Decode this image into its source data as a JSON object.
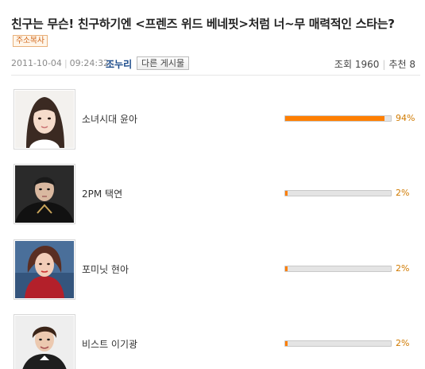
{
  "post": {
    "title": "친구는 무슨! 친구하기엔 <프렌즈 위드 베네핏>처럼 너~무 매력적인 스타는?",
    "copy_address_label": "주소복사",
    "date": "2011-10-04",
    "time": "09:24:32",
    "author": "조누리",
    "other_posts_label": "다른 게시물",
    "views_label": "조회",
    "views": "1960",
    "recommend_label": "추천",
    "recommend": "8"
  },
  "poll": {
    "accent_color": "#ff7f00",
    "items": [
      {
        "name": "소녀시대 윤아",
        "percent_label": "94%",
        "percent": 94,
        "photo": "portrait-photo"
      },
      {
        "name": "2PM 택연",
        "percent_label": "2%",
        "percent": 2,
        "photo": "portrait-photo"
      },
      {
        "name": "포미닛 현아",
        "percent_label": "2%",
        "percent": 2,
        "photo": "portrait-photo"
      },
      {
        "name": "비스트 이기광",
        "percent_label": "2%",
        "percent": 2,
        "photo": "portrait-photo"
      }
    ]
  }
}
